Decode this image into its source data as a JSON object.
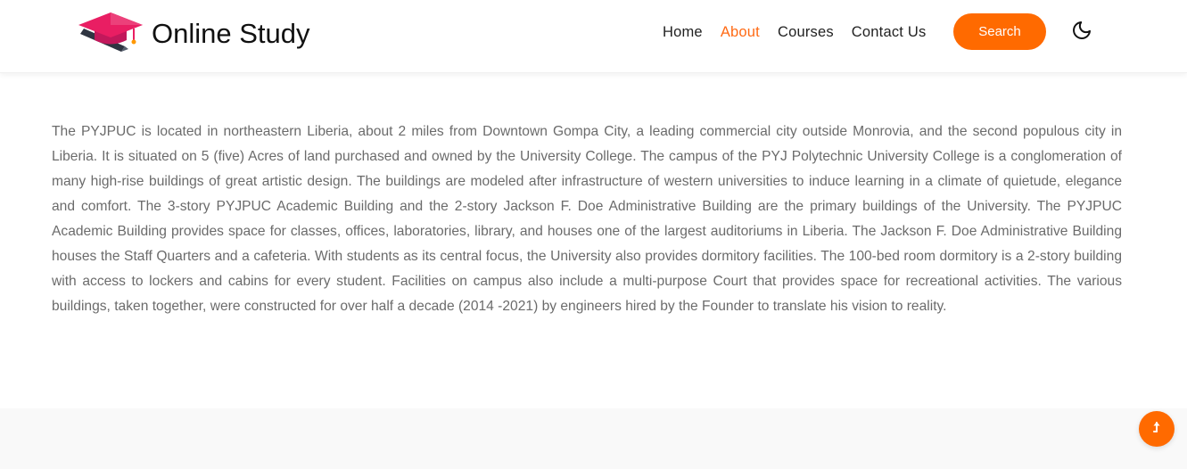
{
  "header": {
    "brand_name": "Online Study",
    "brand_icon": "graduation-cap-icon",
    "nav": [
      {
        "label": "Home",
        "active": false
      },
      {
        "label": "About",
        "active": true
      },
      {
        "label": "Courses",
        "active": false
      },
      {
        "label": "Contact Us",
        "active": false
      }
    ],
    "search_label": "Search",
    "theme_toggle_icon": "moon-icon"
  },
  "main": {
    "about_text": "The PYJPUC is located in northeastern Liberia, about 2 miles from Downtown Gompa City, a leading commercial city outside Monrovia, and the second populous city in Liberia. It is situated on 5 (five) Acres of land purchased and owned by the University College. The campus of the PYJ Polytechnic University College is a conglomeration of many high-rise buildings of great artistic design. The buildings are modeled after infrastructure of western universities to induce learning in a climate of quietude, elegance and comfort. The 3-story PYJPUC Academic Building and the 2-story Jackson F. Doe Administrative Building are the primary buildings of the University. The PYJPUC Academic Building provides space for classes, offices, laboratories, library, and houses one of the largest auditoriums in Liberia. The Jackson F. Doe Administrative Building houses the Staff Quarters and a cafeteria. With students as its central focus, the University also provides dormitory facilities. The 100-bed room dormitory is a 2-story building with access to lockers and cabins for every student. Facilities on campus also include a multi-purpose Court that provides space for recreational activities. The various buildings, taken together, were constructed for over half a decade (2014 -2021) by engineers hired by the Founder to translate his vision to reality."
  },
  "back_to_top_icon": "arrow-up-icon",
  "colors": {
    "accent": "#ff6a00",
    "active_nav": "#ff6a14",
    "body_text": "#6b6b6b",
    "footer_bg": "#f9f9f9"
  }
}
